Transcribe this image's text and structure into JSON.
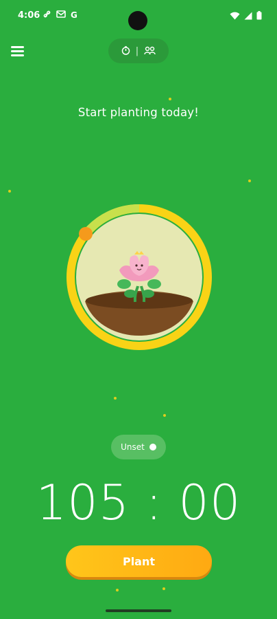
{
  "status_bar": {
    "time": "4:06",
    "left_icons": [
      "fan-icon",
      "mail-icon",
      "google-icon"
    ],
    "google_letter": "G",
    "right_icons": [
      "wifi-icon",
      "signal-icon",
      "battery-icon"
    ]
  },
  "header": {
    "menu_icon": "hamburger-menu-icon",
    "mode_toggle": {
      "left_icon": "timer-icon",
      "separator": "|",
      "right_icon": "group-icon"
    }
  },
  "main": {
    "headline": "Start planting today!",
    "tree": {
      "name": "lotus-plant"
    },
    "tag_label": "Unset",
    "timer": "105 : 00",
    "plant_button": "Plant"
  },
  "colors": {
    "background": "#2aae3e",
    "ring_track": "#f9d316",
    "ring_progress": "#c8e04c",
    "ring_handle": "#f59a1c",
    "button": "#ffb816"
  }
}
